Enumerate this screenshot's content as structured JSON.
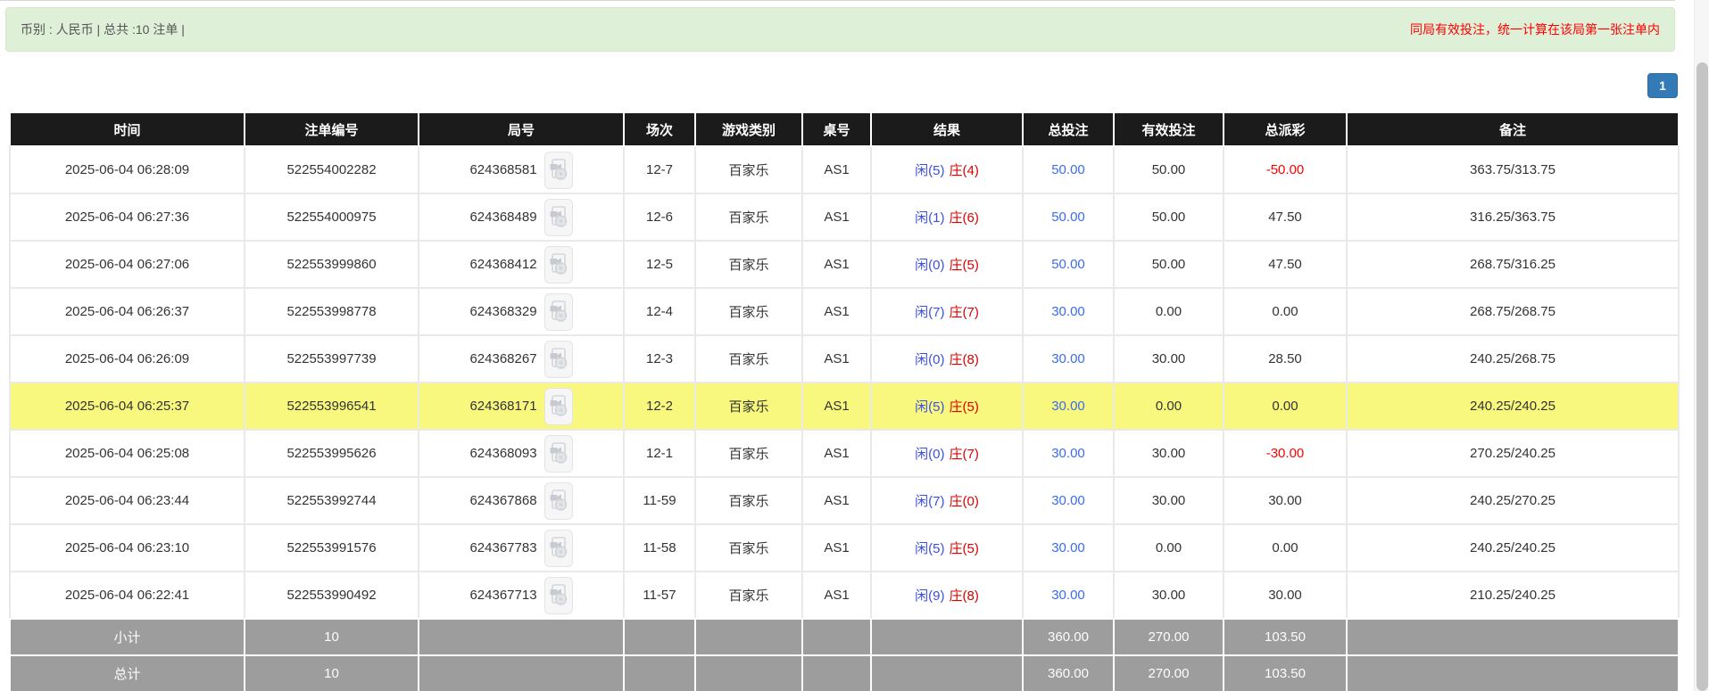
{
  "header_bar": {
    "currency_label": "币别 : 人民币 | 总共 :10 注单 |",
    "notice": "同局有效投注，统一计算在该局第一张注单内"
  },
  "pagination": {
    "page": "1"
  },
  "colors": {
    "alert_bg": "#dff0d8",
    "notice_red": "#ff0000",
    "page_btn_blue": "#337ab7",
    "header_bg": "#1b1b1b",
    "summary_bg": "#9d9d9d",
    "highlight_yellow": "#f8f87e",
    "player_blue": "#3b4fe0",
    "banker_red": "#dd0000",
    "bet_link_blue": "#3d6beb",
    "negative_red": "#ff0000"
  },
  "table": {
    "columns": [
      "时间",
      "注单编号",
      "局号",
      "场次",
      "游戏类别",
      "桌号",
      "结果",
      "总投注",
      "有效投注",
      "总派彩",
      "备注"
    ],
    "video_icon": "video-replay-icon",
    "rows": [
      {
        "time": "2025-06-04 06:28:09",
        "bet_no": "522554002282",
        "round_no": "624368581",
        "session": "12-7",
        "game": "百家乐",
        "table_no": "AS1",
        "player": "闲(5)",
        "banker": "庄(4)",
        "total_bet": "50.00",
        "valid_bet": "50.00",
        "payout": "-50.00",
        "remark": "363.75/313.75",
        "highlight": false
      },
      {
        "time": "2025-06-04 06:27:36",
        "bet_no": "522554000975",
        "round_no": "624368489",
        "session": "12-6",
        "game": "百家乐",
        "table_no": "AS1",
        "player": "闲(1)",
        "banker": "庄(6)",
        "total_bet": "50.00",
        "valid_bet": "50.00",
        "payout": "47.50",
        "remark": "316.25/363.75",
        "highlight": false
      },
      {
        "time": "2025-06-04 06:27:06",
        "bet_no": "522553999860",
        "round_no": "624368412",
        "session": "12-5",
        "game": "百家乐",
        "table_no": "AS1",
        "player": "闲(0)",
        "banker": "庄(5)",
        "total_bet": "50.00",
        "valid_bet": "50.00",
        "payout": "47.50",
        "remark": "268.75/316.25",
        "highlight": false
      },
      {
        "time": "2025-06-04 06:26:37",
        "bet_no": "522553998778",
        "round_no": "624368329",
        "session": "12-4",
        "game": "百家乐",
        "table_no": "AS1",
        "player": "闲(7)",
        "banker": "庄(7)",
        "total_bet": "30.00",
        "valid_bet": "0.00",
        "payout": "0.00",
        "remark": "268.75/268.75",
        "highlight": false
      },
      {
        "time": "2025-06-04 06:26:09",
        "bet_no": "522553997739",
        "round_no": "624368267",
        "session": "12-3",
        "game": "百家乐",
        "table_no": "AS1",
        "player": "闲(0)",
        "banker": "庄(8)",
        "total_bet": "30.00",
        "valid_bet": "30.00",
        "payout": "28.50",
        "remark": "240.25/268.75",
        "highlight": false
      },
      {
        "time": "2025-06-04 06:25:37",
        "bet_no": "522553996541",
        "round_no": "624368171",
        "session": "12-2",
        "game": "百家乐",
        "table_no": "AS1",
        "player": "闲(5)",
        "banker": "庄(5)",
        "total_bet": "30.00",
        "valid_bet": "0.00",
        "payout": "0.00",
        "remark": "240.25/240.25",
        "highlight": true
      },
      {
        "time": "2025-06-04 06:25:08",
        "bet_no": "522553995626",
        "round_no": "624368093",
        "session": "12-1",
        "game": "百家乐",
        "table_no": "AS1",
        "player": "闲(0)",
        "banker": "庄(7)",
        "total_bet": "30.00",
        "valid_bet": "30.00",
        "payout": "-30.00",
        "remark": "270.25/240.25",
        "highlight": false
      },
      {
        "time": "2025-06-04 06:23:44",
        "bet_no": "522553992744",
        "round_no": "624367868",
        "session": "11-59",
        "game": "百家乐",
        "table_no": "AS1",
        "player": "闲(7)",
        "banker": "庄(0)",
        "total_bet": "30.00",
        "valid_bet": "30.00",
        "payout": "30.00",
        "remark": "240.25/270.25",
        "highlight": false
      },
      {
        "time": "2025-06-04 06:23:10",
        "bet_no": "522553991576",
        "round_no": "624367783",
        "session": "11-58",
        "game": "百家乐",
        "table_no": "AS1",
        "player": "闲(5)",
        "banker": "庄(5)",
        "total_bet": "30.00",
        "valid_bet": "0.00",
        "payout": "0.00",
        "remark": "240.25/240.25",
        "highlight": false
      },
      {
        "time": "2025-06-04 06:22:41",
        "bet_no": "522553990492",
        "round_no": "624367713",
        "session": "11-57",
        "game": "百家乐",
        "table_no": "AS1",
        "player": "闲(9)",
        "banker": "庄(8)",
        "total_bet": "30.00",
        "valid_bet": "30.00",
        "payout": "30.00",
        "remark": "210.25/240.25",
        "highlight": false
      }
    ],
    "summary": [
      {
        "label": "小计",
        "count": "10",
        "total_bet": "360.00",
        "valid_bet": "270.00",
        "payout": "103.50"
      },
      {
        "label": "总计",
        "count": "10",
        "total_bet": "360.00",
        "valid_bet": "270.00",
        "payout": "103.50"
      }
    ]
  }
}
